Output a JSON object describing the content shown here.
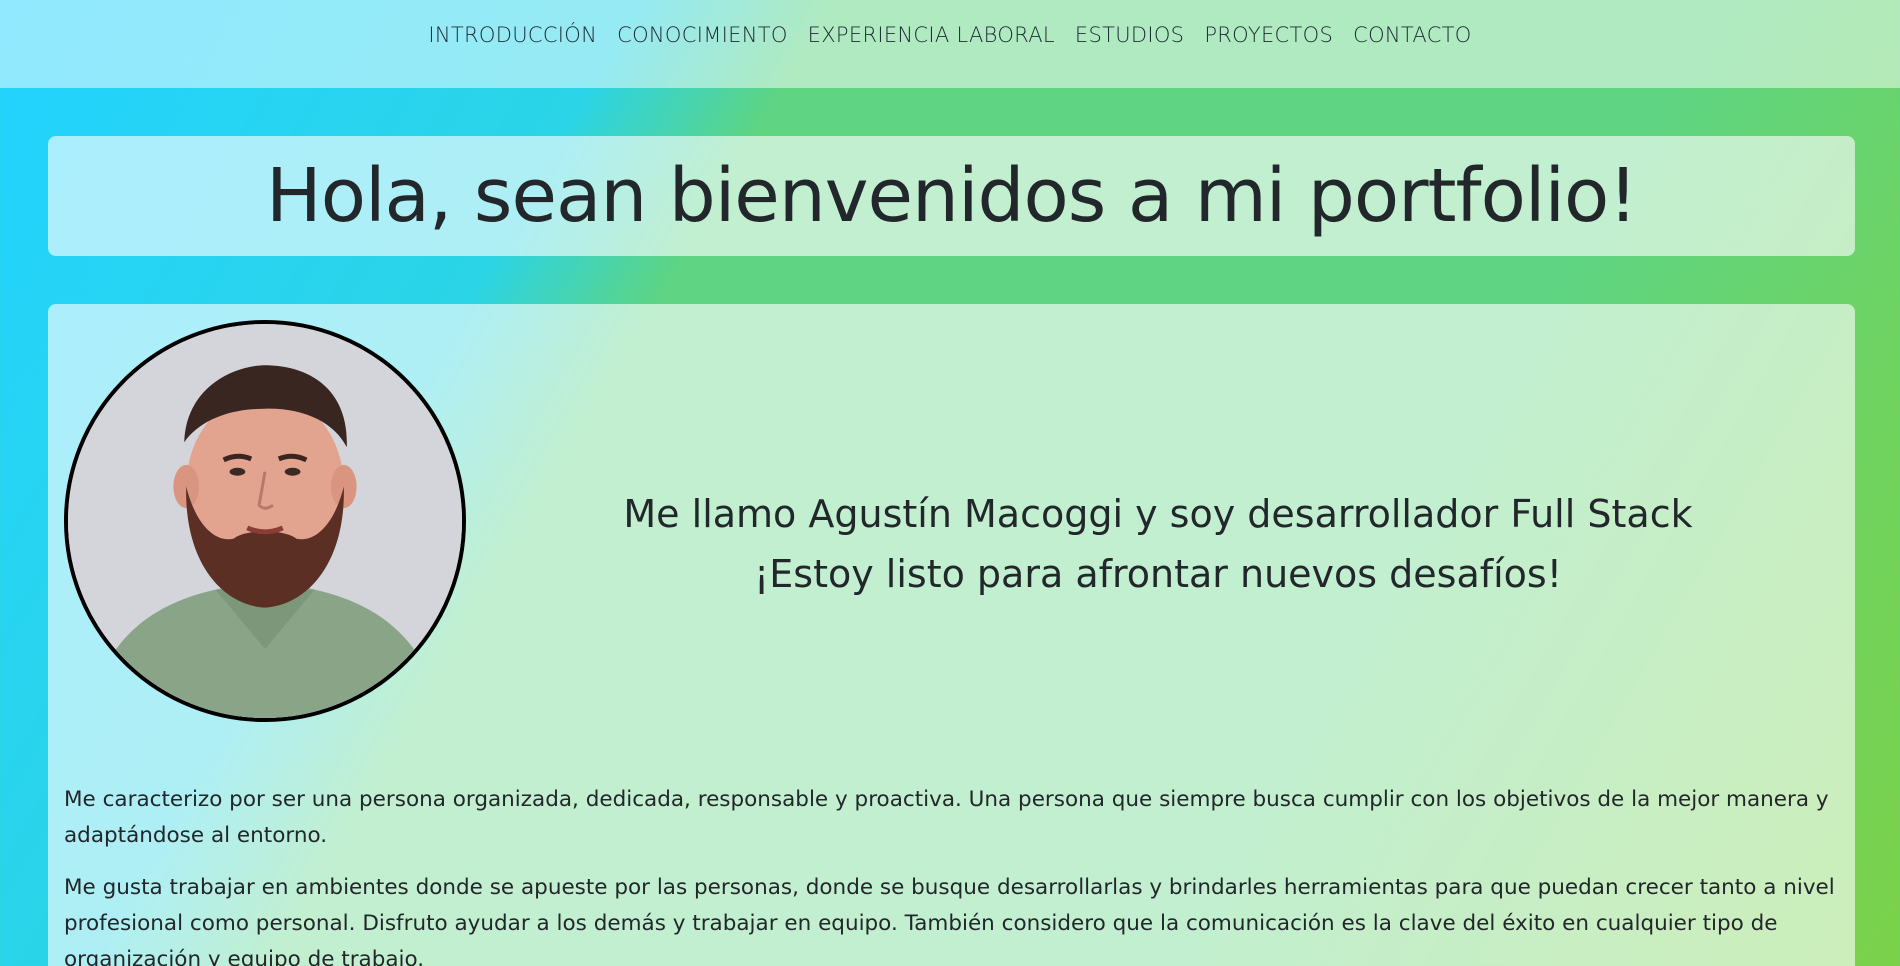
{
  "nav": {
    "items": [
      {
        "label": "INTRODUCCIÓN"
      },
      {
        "label": "CONOCIMIENTO"
      },
      {
        "label": "EXPERIENCIA LABORAL"
      },
      {
        "label": "ESTUDIOS"
      },
      {
        "label": "PROYECTOS"
      },
      {
        "label": "CONTACTO"
      }
    ]
  },
  "header": {
    "title": "Hola, sean bienvenidos a mi portfolio!"
  },
  "intro": {
    "avatar_icon": "profile-photo",
    "headline_line1": "Me llamo Agustín Macoggi y soy desarrollador Full Stack",
    "headline_line2": "¡Estoy listo para afrontar nuevos desafíos!",
    "paragraphs": [
      "Me caracterizo por ser una persona organizada, dedicada, responsable y proactiva. Una persona que siempre busca cumplir con los objetivos de la mejor manera y adaptándose al entorno.",
      "Me gusta trabajar en ambientes donde se apueste por las personas, donde se busque desarrollarlas y brindarles herramientas para que puedan crecer tanto a nivel profesional como personal. Disfruto ayudar a los demás y trabajar en equipo. También considero que la comunicación es la clave del éxito en cualquier tipo de organización y equipo de trabajo."
    ]
  },
  "colors": {
    "gradient_cyan": "#22d3ff",
    "gradient_green": "#5fd482",
    "gradient_lime": "#7bd24a",
    "text": "#22272b"
  }
}
